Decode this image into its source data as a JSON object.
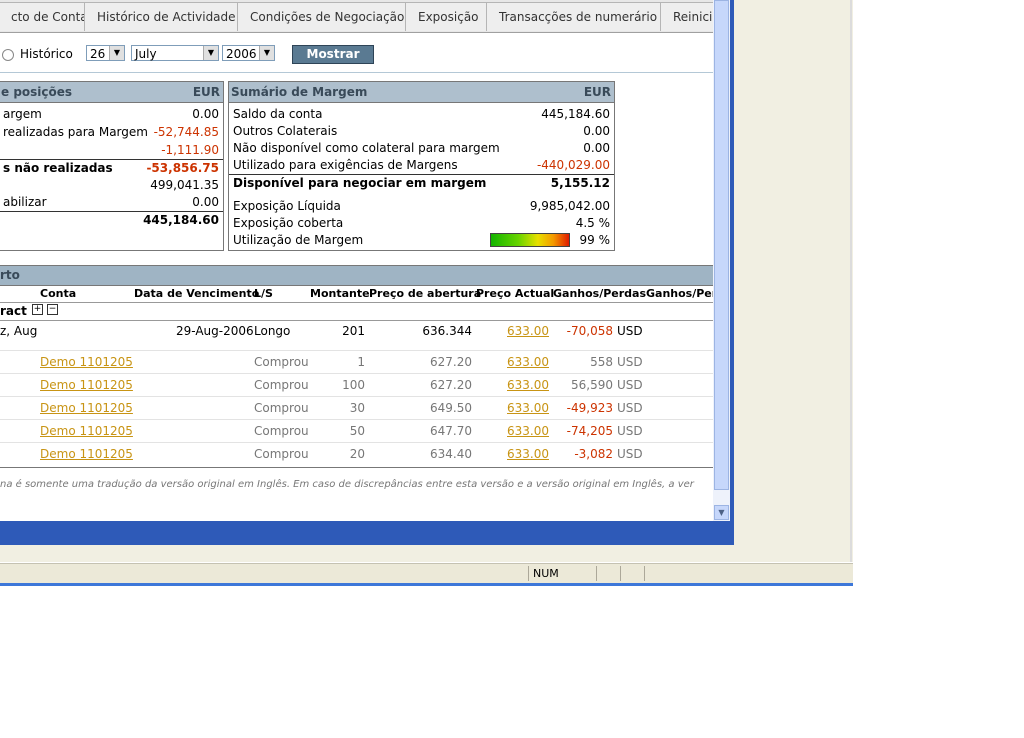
{
  "tabs": [
    "cto de Conta",
    "Histórico de Actividade",
    "Condições de Negociação",
    "Exposição",
    "Transacções de numerário",
    "Reinicia"
  ],
  "controls": {
    "radio_label": "Histórico",
    "day": "26",
    "month": "July",
    "year": "2006",
    "show_button": "Mostrar"
  },
  "left_panel": {
    "title": "e posições",
    "currency": "EUR",
    "rows": [
      {
        "label": "argem",
        "value": "0.00"
      },
      {
        "label": "realizadas para Margem",
        "value": "-52,744.85"
      },
      {
        "label": "",
        "value": "-1,111.90"
      },
      {
        "label": "s não realizadas",
        "value": "-53,856.75"
      },
      {
        "label": "",
        "value": "499,041.35"
      },
      {
        "label": "abilizar",
        "value": "0.00"
      },
      {
        "label": "",
        "value": "445,184.60"
      }
    ]
  },
  "margin_panel": {
    "title": "Sumário de Margem",
    "currency": "EUR",
    "rows": [
      {
        "label": "Saldo da conta",
        "value": "445,184.60"
      },
      {
        "label": "Outros Colaterais",
        "value": "0.00"
      },
      {
        "label": "Não disponível como colateral para margem",
        "value": "0.00"
      },
      {
        "label": "Utilizado para exigências de Margens",
        "value": "-440,029.00"
      },
      {
        "label": "Disponível para negociar em margem",
        "value": "5,155.12"
      },
      {
        "label": "Exposição Líquida",
        "value": "9,985,042.00"
      },
      {
        "label": "Exposição coberta",
        "value": "4.5 %"
      },
      {
        "label": "Utilização de Margem",
        "value": "99 %"
      }
    ],
    "margin_utilization_fraction": 0.99
  },
  "positions": {
    "title": "rto",
    "columns": [
      "Conta",
      "Data de Vencimento",
      "L/S",
      "Montante",
      "Preço de abertura",
      "Preço Actual",
      "Ganhos/Perdas",
      "Ganhos/Per"
    ],
    "group_label": "ract",
    "summary": {
      "name": "z, Aug",
      "date": "29-Aug-2006",
      "ls": "Longo",
      "amount": "201",
      "open": "636.344",
      "current": "633.00",
      "pl": "-70,058",
      "ccy": "USD"
    },
    "trades": [
      {
        "account": "Demo 1101205",
        "ls": "Comprou",
        "amount": "1",
        "open": "627.20",
        "current": "633.00",
        "pl": "558",
        "ccy": "USD"
      },
      {
        "account": "Demo 1101205",
        "ls": "Comprou",
        "amount": "100",
        "open": "627.20",
        "current": "633.00",
        "pl": "56,590",
        "ccy": "USD"
      },
      {
        "account": "Demo 1101205",
        "ls": "Comprou",
        "amount": "30",
        "open": "649.50",
        "current": "633.00",
        "pl": "-49,923",
        "ccy": "USD"
      },
      {
        "account": "Demo 1101205",
        "ls": "Comprou",
        "amount": "50",
        "open": "647.70",
        "current": "633.00",
        "pl": "-74,205",
        "ccy": "USD"
      },
      {
        "account": "Demo 1101205",
        "ls": "Comprou",
        "amount": "20",
        "open": "634.40",
        "current": "633.00",
        "pl": "-3,082",
        "ccy": "USD"
      }
    ]
  },
  "disclaimer": "na é somente uma tradução da versão original em Inglês. Em caso de discrepâncias entre esta versão e a versão original em Inglês, a ver",
  "status": {
    "num": "NUM"
  }
}
